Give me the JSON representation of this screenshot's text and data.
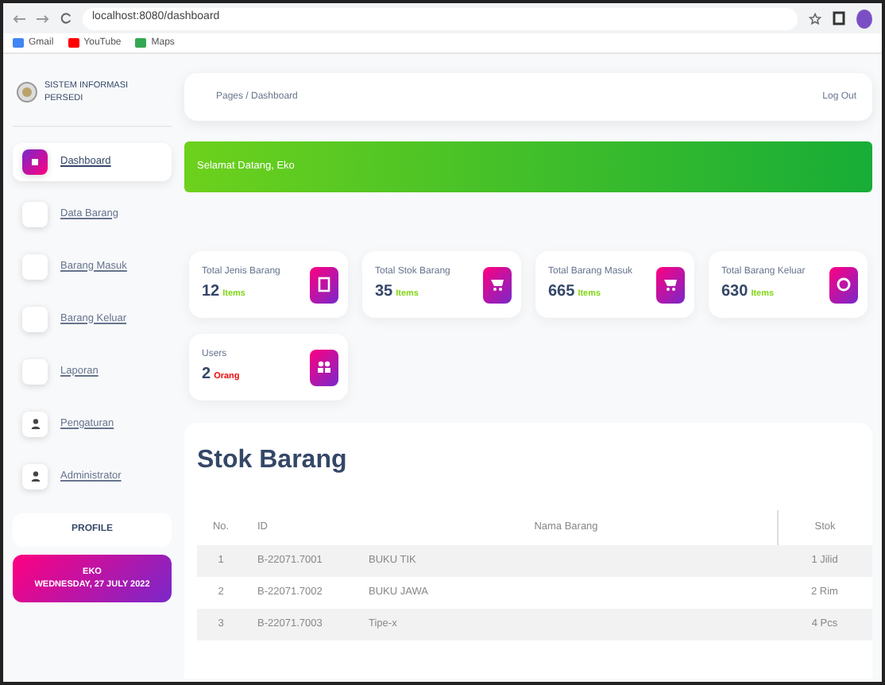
{
  "browser": {
    "url": "localhost:8080/dashboard",
    "bookmarks": [
      "Gmail",
      "YouTube",
      "Maps"
    ]
  },
  "sidebar": {
    "brand": "SISTEM INFORMASI PERSEDI",
    "items": [
      {
        "label": "Dashboard",
        "selected": true,
        "kind": "box"
      },
      {
        "label": "Data Barang",
        "selected": false,
        "kind": "box"
      },
      {
        "label": "Barang Masuk",
        "selected": false,
        "kind": "box"
      },
      {
        "label": "Barang Keluar",
        "selected": false,
        "kind": "box"
      },
      {
        "label": "Laporan",
        "selected": false,
        "kind": "box"
      },
      {
        "label": "Pengaturan",
        "selected": false,
        "kind": "user"
      },
      {
        "label": "Administrator",
        "selected": false,
        "kind": "user"
      }
    ],
    "profile_button": "PROFILE",
    "user_name": "EKO",
    "date": "WEDNESDAY, 27 JULY 2022"
  },
  "header": {
    "breadcrumb": "Pages / Dashboard",
    "logout": "Log Out"
  },
  "banner": "Selamat Datang, Eko",
  "stats": [
    {
      "label": "Total Jenis Barang",
      "value": "12",
      "unit": "Items",
      "color": "#82d616",
      "kind": "doc"
    },
    {
      "label": "Total Stok Barang",
      "value": "35",
      "unit": "Items",
      "color": "#82d616",
      "kind": "cart"
    },
    {
      "label": "Total Barang Masuk",
      "value": "665",
      "unit": "Items",
      "color": "#82d616",
      "kind": "cart"
    },
    {
      "label": "Total Barang Keluar",
      "value": "630",
      "unit": "Items",
      "color": "#82d616",
      "kind": "coin"
    },
    {
      "label": "Users",
      "value": "2",
      "unit": "Orang",
      "color": "#ea0606",
      "kind": "users"
    }
  ],
  "table": {
    "title": "Stok Barang",
    "columns": [
      "No.",
      "ID",
      "Nama Barang",
      "Stok"
    ],
    "rows": [
      [
        "1",
        "B-22071.7001",
        "BUKU TIK",
        "1 Jilid"
      ],
      [
        "2",
        "B-22071.7002",
        "BUKU JAWA",
        "2 Rim"
      ],
      [
        "3",
        "B-22071.7003",
        "Tipe-x",
        "4 Pcs"
      ]
    ]
  }
}
